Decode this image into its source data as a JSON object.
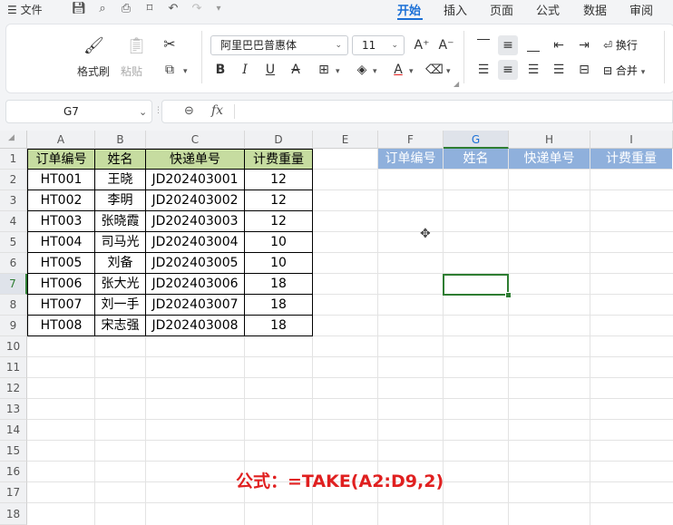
{
  "menubar": {
    "file_label": "文件",
    "tabs": [
      "开始",
      "插入",
      "页面",
      "公式",
      "数据",
      "审阅"
    ]
  },
  "ribbon": {
    "format_painter": "格式刷",
    "paste": "粘贴",
    "font_name": "阿里巴巴普惠体",
    "font_size": "11",
    "wrap": "换行",
    "merge": "合并"
  },
  "formula_bar": {
    "name_box": "G7",
    "fx": "fx",
    "formula": ""
  },
  "sheet": {
    "columns": [
      "A",
      "B",
      "C",
      "D",
      "E",
      "F",
      "G",
      "H",
      "I"
    ],
    "rows": [
      "1",
      "2",
      "3",
      "4",
      "5",
      "6",
      "7",
      "8",
      "9",
      "10",
      "11",
      "12",
      "13",
      "14",
      "15",
      "16",
      "17",
      "18"
    ],
    "headers": [
      "订单编号",
      "姓名",
      "快递单号",
      "计费重量"
    ],
    "data": [
      [
        "HT001",
        "王晓",
        "JD202403001",
        "12"
      ],
      [
        "HT002",
        "李明",
        "JD202403002",
        "12"
      ],
      [
        "HT003",
        "张晓霞",
        "JD202403003",
        "12"
      ],
      [
        "HT004",
        "司马光",
        "JD202403004",
        "10"
      ],
      [
        "HT005",
        "刘备",
        "JD202403005",
        "10"
      ],
      [
        "HT006",
        "张大光",
        "JD202403006",
        "18"
      ],
      [
        "HT007",
        "刘一手",
        "JD202403007",
        "18"
      ],
      [
        "HT008",
        "宋志强",
        "JD202403008",
        "18"
      ]
    ],
    "result_headers": [
      "订单编号",
      "姓名",
      "快递单号",
      "计费重量"
    ],
    "note": "公式：=TAKE(A2:D9,2)"
  },
  "colors": {
    "accent": "#1a6fd6",
    "header_green": "#c6dca0",
    "header_blue": "#8fb0dc",
    "selection": "#2e7d32",
    "note_red": "#e02020"
  }
}
